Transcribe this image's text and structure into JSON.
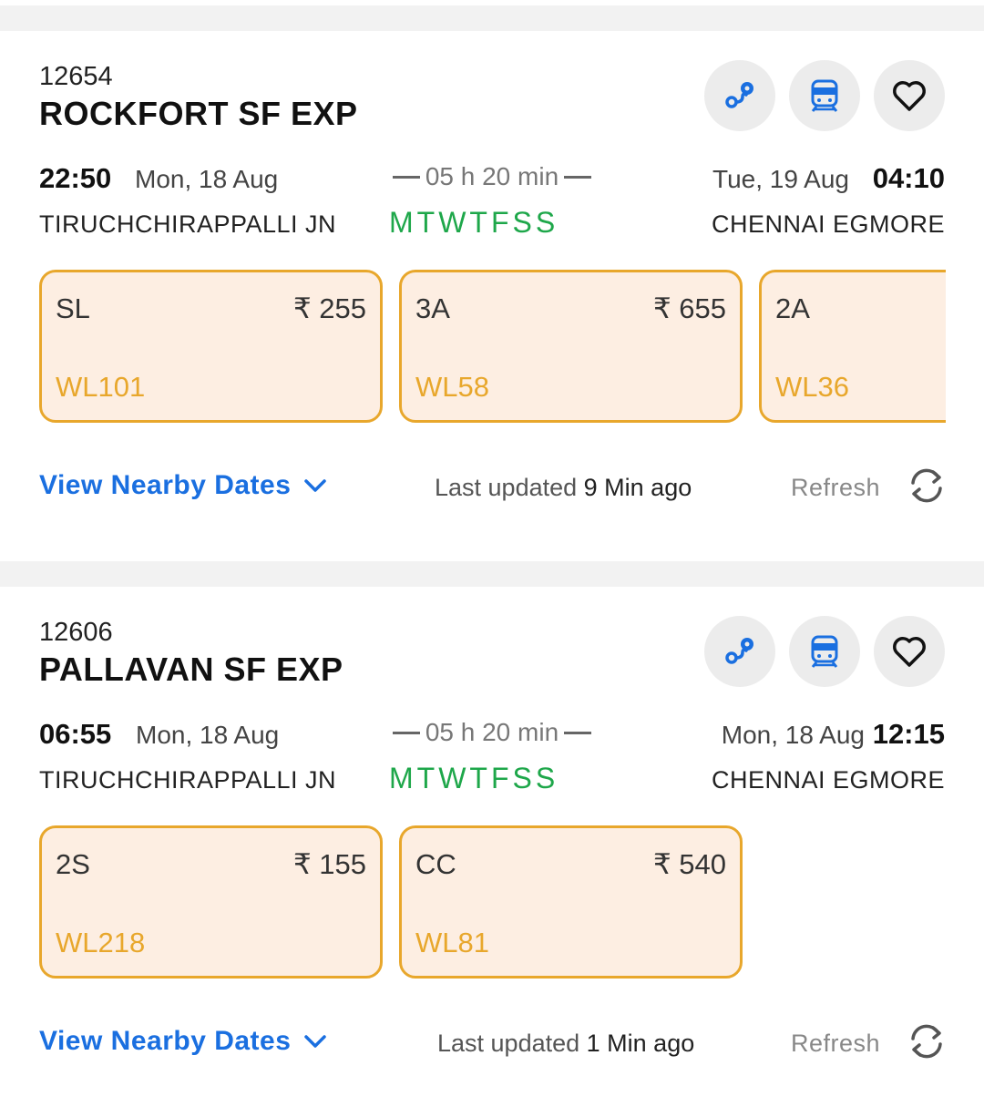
{
  "trains": [
    {
      "number": "12654",
      "name": "ROCKFORT SF EXP",
      "departure": {
        "time": "22:50",
        "date": "Mon, 18 Aug",
        "station": "TIRUCHCHIRAPPALLI JN"
      },
      "duration": "05 h 20 min",
      "run_days": "MTWTFSS",
      "arrival": {
        "time": "04:10",
        "date": "Tue, 19 Aug",
        "station": "CHENNAI EGMORE"
      },
      "classes": [
        {
          "code": "SL",
          "fare": "₹ 255",
          "availability": "WL101"
        },
        {
          "code": "3A",
          "fare": "₹ 655",
          "availability": "WL58"
        },
        {
          "code": "2A",
          "fare": "",
          "availability": "WL36"
        }
      ],
      "nearby_label": "View Nearby Dates",
      "last_updated_prefix": "Last updated",
      "last_updated_value": "9 Min ago",
      "refresh_label": "Refresh"
    },
    {
      "number": "12606",
      "name": "PALLAVAN SF EXP",
      "departure": {
        "time": "06:55",
        "date": "Mon, 18 Aug",
        "station": "TIRUCHCHIRAPPALLI JN"
      },
      "duration": "05 h 20 min",
      "run_days": "MTWTFSS",
      "arrival": {
        "time": "12:15",
        "date": "Mon, 18 Aug",
        "station": "CHENNAI EGMORE"
      },
      "classes": [
        {
          "code": "2S",
          "fare": "₹ 155",
          "availability": "WL218"
        },
        {
          "code": "CC",
          "fare": "₹ 540",
          "availability": "WL81"
        }
      ],
      "nearby_label": "View Nearby Dates",
      "last_updated_prefix": "Last updated",
      "last_updated_value": "1 Min ago",
      "refresh_label": "Refresh"
    }
  ],
  "icons": {
    "route": "route-map-icon",
    "coach": "train-coach-icon",
    "favorite": "heart-icon",
    "expand": "chevron-down-icon",
    "refresh": "refresh-icon"
  },
  "colors": {
    "accent_blue": "#1a6fe0",
    "run_days_green": "#1ea74a",
    "waitlist_orange": "#e8a72c",
    "class_box_bg": "#fdeee2"
  }
}
